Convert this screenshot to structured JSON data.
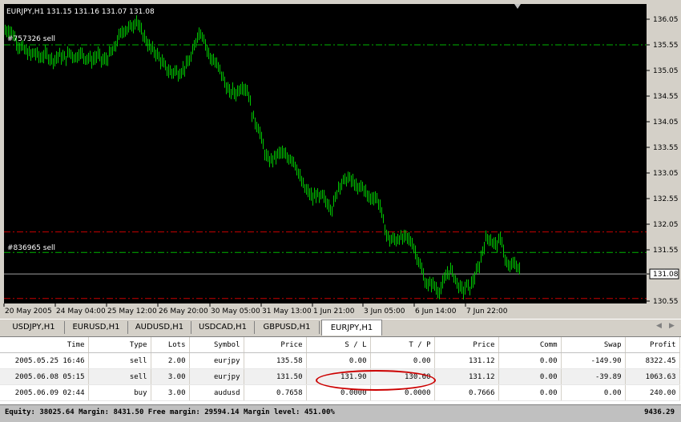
{
  "chart": {
    "header": "EURJPY,H1  131.15 131.16 131.07 131.08",
    "current_price": "131.08",
    "order_labels": [
      "#757326 sell",
      "#836965 sell"
    ],
    "price_ticks": [
      "136.05",
      "135.55",
      "135.05",
      "134.55",
      "134.05",
      "133.55",
      "133.05",
      "132.55",
      "132.05",
      "131.55",
      "131.08",
      "130.55"
    ],
    "time_ticks": [
      "20 May 2005",
      "24 May 04:00",
      "25 May 12:00",
      "26 May 20:00",
      "30 May 05:00",
      "31 May 13:00",
      "1 Jun 21:00",
      "3 Jun 05:00",
      "6 Jun 14:00",
      "7 Jun 22:00"
    ],
    "colors": {
      "background": "#000000",
      "candles": "#00c800",
      "green_line": "#00b400",
      "red_line": "#c80000",
      "text": "#ffffff"
    }
  },
  "chart_data": {
    "type": "line",
    "symbol": "EURJPY",
    "timeframe": "H1",
    "x": [
      "20 May 2005",
      "24 May 04:00",
      "25 May 12:00",
      "26 May 20:00",
      "30 May 05:00",
      "31 May 13:00",
      "1 Jun 21:00",
      "3 Jun 05:00",
      "6 Jun 14:00",
      "7 Jun 22:00"
    ],
    "path": [
      [
        0,
        135.83
      ],
      [
        4,
        135.85
      ],
      [
        8,
        135.8
      ],
      [
        12,
        135.7
      ],
      [
        16,
        135.55
      ],
      [
        20,
        135.5
      ],
      [
        24,
        135.45
      ],
      [
        28,
        135.4
      ],
      [
        32,
        135.35
      ],
      [
        36,
        135.4
      ],
      [
        40,
        135.35
      ],
      [
        44,
        135.3
      ],
      [
        48,
        135.35
      ],
      [
        52,
        135.35
      ],
      [
        56,
        135.3
      ],
      [
        60,
        135.25
      ],
      [
        64,
        135.3
      ],
      [
        68,
        135.35
      ],
      [
        72,
        135.3
      ],
      [
        76,
        135.3
      ],
      [
        80,
        135.4
      ],
      [
        84,
        135.35
      ],
      [
        88,
        135.3
      ],
      [
        92,
        135.4
      ],
      [
        96,
        135.35
      ],
      [
        100,
        135.3
      ],
      [
        104,
        135.3
      ],
      [
        108,
        135.25
      ],
      [
        112,
        135.3
      ],
      [
        116,
        135.35
      ],
      [
        120,
        135.25
      ],
      [
        124,
        135.25
      ],
      [
        128,
        135.3
      ],
      [
        132,
        135.4
      ],
      [
        136,
        135.45
      ],
      [
        140,
        135.65
      ],
      [
        144,
        135.75
      ],
      [
        148,
        135.85
      ],
      [
        152,
        135.85
      ],
      [
        156,
        135.9
      ],
      [
        160,
        135.95
      ],
      [
        164,
        136.05
      ],
      [
        168,
        135.85
      ],
      [
        172,
        135.75
      ],
      [
        176,
        135.65
      ],
      [
        180,
        135.5
      ],
      [
        184,
        135.45
      ],
      [
        188,
        135.4
      ],
      [
        192,
        135.3
      ],
      [
        196,
        135.2
      ],
      [
        200,
        135.1
      ],
      [
        204,
        135.05
      ],
      [
        208,
        135.0
      ],
      [
        212,
        135.05
      ],
      [
        216,
        135.0
      ],
      [
        220,
        135.05
      ],
      [
        224,
        135.1
      ],
      [
        228,
        135.2
      ],
      [
        232,
        135.3
      ],
      [
        236,
        135.5
      ],
      [
        240,
        135.75
      ],
      [
        244,
        135.8
      ],
      [
        248,
        135.7
      ],
      [
        252,
        135.45
      ],
      [
        256,
        135.3
      ],
      [
        260,
        135.25
      ],
      [
        264,
        135.15
      ],
      [
        268,
        135.05
      ],
      [
        272,
        134.9
      ],
      [
        276,
        134.75
      ],
      [
        280,
        134.6
      ],
      [
        284,
        134.65
      ],
      [
        288,
        134.6
      ],
      [
        292,
        134.7
      ],
      [
        296,
        134.75
      ],
      [
        300,
        134.7
      ],
      [
        304,
        134.6
      ],
      [
        308,
        134.2
      ],
      [
        312,
        134.05
      ],
      [
        316,
        133.95
      ],
      [
        320,
        133.7
      ],
      [
        324,
        133.45
      ],
      [
        328,
        133.3
      ],
      [
        332,
        133.3
      ],
      [
        336,
        133.35
      ],
      [
        340,
        133.4
      ],
      [
        344,
        133.45
      ],
      [
        348,
        133.4
      ],
      [
        352,
        133.35
      ],
      [
        356,
        133.35
      ],
      [
        360,
        133.3
      ],
      [
        364,
        133.15
      ],
      [
        368,
        132.95
      ],
      [
        372,
        132.8
      ],
      [
        376,
        132.7
      ],
      [
        380,
        132.65
      ],
      [
        384,
        132.55
      ],
      [
        388,
        132.65
      ],
      [
        392,
        132.55
      ],
      [
        396,
        132.6
      ],
      [
        400,
        132.5
      ],
      [
        404,
        132.45
      ],
      [
        408,
        132.35
      ],
      [
        412,
        132.55
      ],
      [
        416,
        132.8
      ],
      [
        420,
        132.85
      ],
      [
        424,
        132.9
      ],
      [
        428,
        132.95
      ],
      [
        432,
        132.9
      ],
      [
        436,
        132.85
      ],
      [
        440,
        132.7
      ],
      [
        444,
        132.8
      ],
      [
        448,
        132.75
      ],
      [
        452,
        132.6
      ],
      [
        456,
        132.55
      ],
      [
        460,
        132.6
      ],
      [
        464,
        132.55
      ],
      [
        468,
        132.4
      ],
      [
        472,
        132.1
      ],
      [
        476,
        131.85
      ],
      [
        480,
        131.75
      ],
      [
        484,
        131.75
      ],
      [
        488,
        131.75
      ],
      [
        492,
        131.8
      ],
      [
        496,
        131.75
      ],
      [
        500,
        131.8
      ],
      [
        504,
        131.75
      ],
      [
        508,
        131.7
      ],
      [
        512,
        131.5
      ],
      [
        516,
        131.35
      ],
      [
        520,
        131.15
      ],
      [
        524,
        130.95
      ],
      [
        528,
        130.85
      ],
      [
        532,
        130.9
      ],
      [
        536,
        130.85
      ],
      [
        540,
        130.75
      ],
      [
        544,
        130.8
      ],
      [
        548,
        130.95
      ],
      [
        552,
        131.1
      ],
      [
        556,
        131.15
      ],
      [
        560,
        131.05
      ],
      [
        564,
        130.9
      ],
      [
        568,
        130.8
      ],
      [
        572,
        130.75
      ],
      [
        576,
        130.85
      ],
      [
        580,
        130.8
      ],
      [
        584,
        130.95
      ],
      [
        588,
        131.1
      ],
      [
        592,
        131.25
      ],
      [
        596,
        131.55
      ],
      [
        600,
        131.75
      ],
      [
        604,
        131.8
      ],
      [
        608,
        131.7
      ],
      [
        612,
        131.65
      ],
      [
        616,
        131.7
      ],
      [
        620,
        131.75
      ],
      [
        624,
        131.35
      ],
      [
        628,
        131.2
      ],
      [
        632,
        131.25
      ],
      [
        636,
        131.3
      ],
      [
        640,
        131.2
      ],
      [
        644,
        131.1
      ]
    ],
    "y_ticks": [
      136.05,
      135.55,
      135.05,
      134.55,
      134.05,
      133.55,
      133.05,
      132.55,
      132.05,
      131.55,
      131.08,
      130.55
    ],
    "levels": [
      {
        "price": 135.55,
        "color": "green"
      },
      {
        "price": 131.9,
        "color": "red"
      },
      {
        "price": 131.5,
        "color": "green"
      },
      {
        "price": 131.08,
        "color": "grey"
      },
      {
        "price": 130.6,
        "color": "red"
      }
    ]
  },
  "tabs": [
    {
      "label": "USDJPY,H1",
      "active": false
    },
    {
      "label": "EURUSD,H1",
      "active": false
    },
    {
      "label": "AUDUSD,H1",
      "active": false
    },
    {
      "label": "USDCAD,H1",
      "active": false
    },
    {
      "label": "GBPUSD,H1",
      "active": false
    },
    {
      "label": "EURJPY,H1",
      "active": true
    }
  ],
  "tab_arrows": {
    "left": "◀",
    "right": "▶"
  },
  "terminal": {
    "columns": [
      "Time",
      "Type",
      "Lots",
      "Symbol",
      "Price",
      "S / L",
      "T / P",
      "Price",
      "Comm",
      "Swap",
      "Profit"
    ],
    "rows": [
      [
        "2005.05.25 16:46",
        "sell",
        "2.00",
        "eurjpy",
        "135.58",
        "0.00",
        "0.00",
        "131.12",
        "0.00",
        "-149.90",
        "8322.45"
      ],
      [
        "2005.06.08 05:15",
        "sell",
        "3.00",
        "eurjpy",
        "131.50",
        "131.90",
        "130.60",
        "131.12",
        "0.00",
        "-39.89",
        "1063.63"
      ],
      [
        "2005.06.09 02:44",
        "buy",
        "3.00",
        "audusd",
        "0.7658",
        "0.0000",
        "0.0000",
        "0.7666",
        "0.00",
        "0.00",
        "240.00"
      ]
    ],
    "status": "Equity: 38025.64  Margin: 8431.50  Free margin: 29594.14  Margin level: 451.00%",
    "total_profit": "9436.29"
  }
}
